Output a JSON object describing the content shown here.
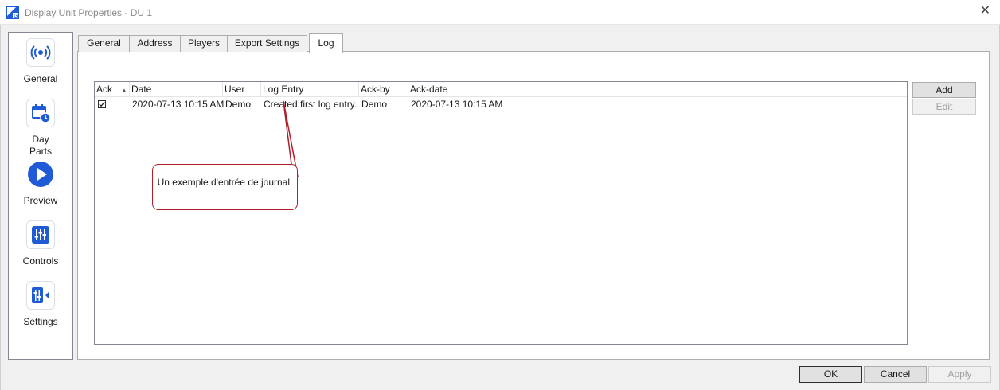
{
  "window": {
    "title": "Display Unit Properties - DU 1",
    "close_glyph": "✕"
  },
  "sidebar": {
    "items": [
      {
        "label": "General",
        "icon": "broadcast-icon"
      },
      {
        "label": "Day\nParts",
        "icon": "calendar-clock-icon"
      },
      {
        "label": "Preview",
        "icon": "play-icon"
      },
      {
        "label": "Controls",
        "icon": "sliders-icon"
      },
      {
        "label": "Settings",
        "icon": "settings-panel-icon"
      }
    ]
  },
  "tabs": [
    {
      "label": "General",
      "active": false
    },
    {
      "label": "Address",
      "active": false
    },
    {
      "label": "Players",
      "active": false
    },
    {
      "label": "Export Settings",
      "active": false
    },
    {
      "label": "Log",
      "active": true
    }
  ],
  "log": {
    "columns": [
      "Ack",
      "Date",
      "User",
      "Log Entry",
      "Ack-by",
      "Ack-date"
    ],
    "sort_glyph": "▲",
    "rows": [
      {
        "ack": true,
        "date": "2020-07-13 10:15 AM",
        "user": "Demo",
        "entry": "Created first log entry.",
        "ack_by": "Demo",
        "ack_date": "2020-07-13 10:15 AM"
      }
    ]
  },
  "side_buttons": {
    "add": "Add",
    "edit": "Edit"
  },
  "footer": {
    "ok": "OK",
    "cancel": "Cancel",
    "apply": "Apply"
  },
  "annotation": {
    "text": "Un exemple d'entrée de journal."
  },
  "colors": {
    "accent_blue": "#1f5bd6",
    "callout_red": "#b01e2a",
    "window_bg": "#f0f0f0"
  }
}
